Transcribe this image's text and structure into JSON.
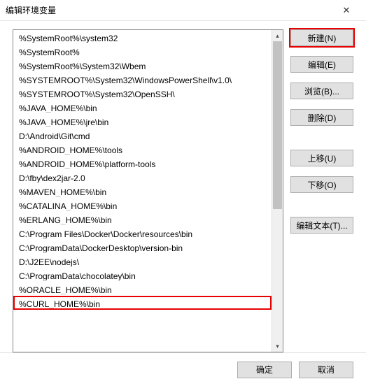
{
  "window": {
    "title": "编辑环境变量"
  },
  "list": {
    "items": [
      "%SystemRoot%\\system32",
      "%SystemRoot%",
      "%SystemRoot%\\System32\\Wbem",
      "%SYSTEMROOT%\\System32\\WindowsPowerShell\\v1.0\\",
      "%SYSTEMROOT%\\System32\\OpenSSH\\",
      "%JAVA_HOME%\\bin",
      "%JAVA_HOME%\\jre\\bin",
      "D:\\Android\\Git\\cmd",
      "%ANDROID_HOME%\\tools",
      "%ANDROID_HOME%\\platform-tools",
      "D:\\fby\\dex2jar-2.0",
      "%MAVEN_HOME%\\bin",
      "%CATALINA_HOME%\\bin",
      "%ERLANG_HOME%\\bin",
      "C:\\Program Files\\Docker\\Docker\\resources\\bin",
      "C:\\ProgramData\\DockerDesktop\\version-bin",
      "D:\\J2EE\\nodejs\\",
      "C:\\ProgramData\\chocolatey\\bin",
      "%ORACLE_HOME%\\bin",
      "%CURL_HOME%\\bin"
    ],
    "highlight_index": 19
  },
  "buttons": {
    "new": "新建(N)",
    "edit": "编辑(E)",
    "browse": "浏览(B)...",
    "delete": "删除(D)",
    "move_up": "上移(U)",
    "move_down": "下移(O)",
    "edit_text": "编辑文本(T)...",
    "ok": "确定",
    "cancel": "取消"
  }
}
